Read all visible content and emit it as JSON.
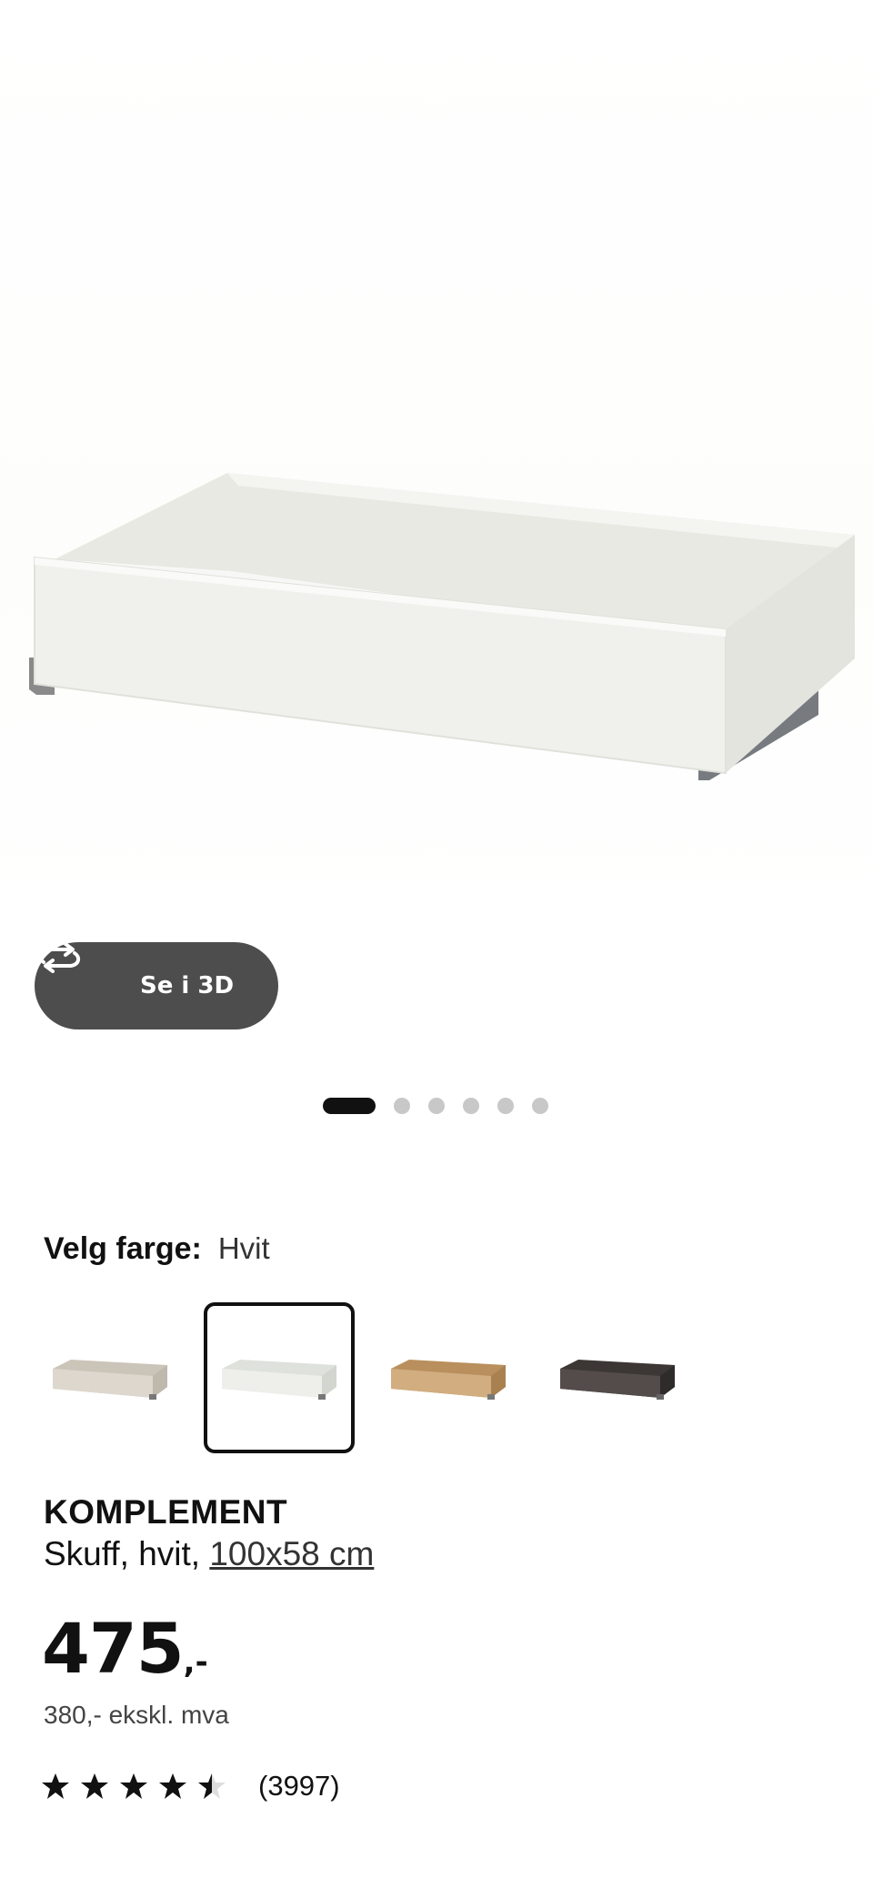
{
  "gallery": {
    "view3d_label": "Se i 3D",
    "dot_count": 6,
    "active_index": 0
  },
  "color_selector": {
    "label": "Velg farge:",
    "selected_value": "Hvit",
    "options": [
      {
        "name": "beige",
        "fill": "#d8d2c8"
      },
      {
        "name": "hvit",
        "fill": "#e9ebe6",
        "selected": true
      },
      {
        "name": "eik",
        "fill": "#c8a57a"
      },
      {
        "name": "mørk",
        "fill": "#4b4543"
      }
    ]
  },
  "product": {
    "name": "KOMPLEMENT",
    "desc_prefix": "Skuff, hvit, ",
    "dimensions": "100x58 cm",
    "price_main": "475",
    "price_suffix": ",-",
    "ex_vat": "380,- ekskl. mva",
    "rating": 4.5,
    "review_count": "(3997)"
  },
  "colors": {
    "pill_bg": "#4d4d4d",
    "dot_active": "#111111",
    "dot_inactive": "#c8c8c8",
    "star": "#111111",
    "star_empty": "#dddddd"
  }
}
